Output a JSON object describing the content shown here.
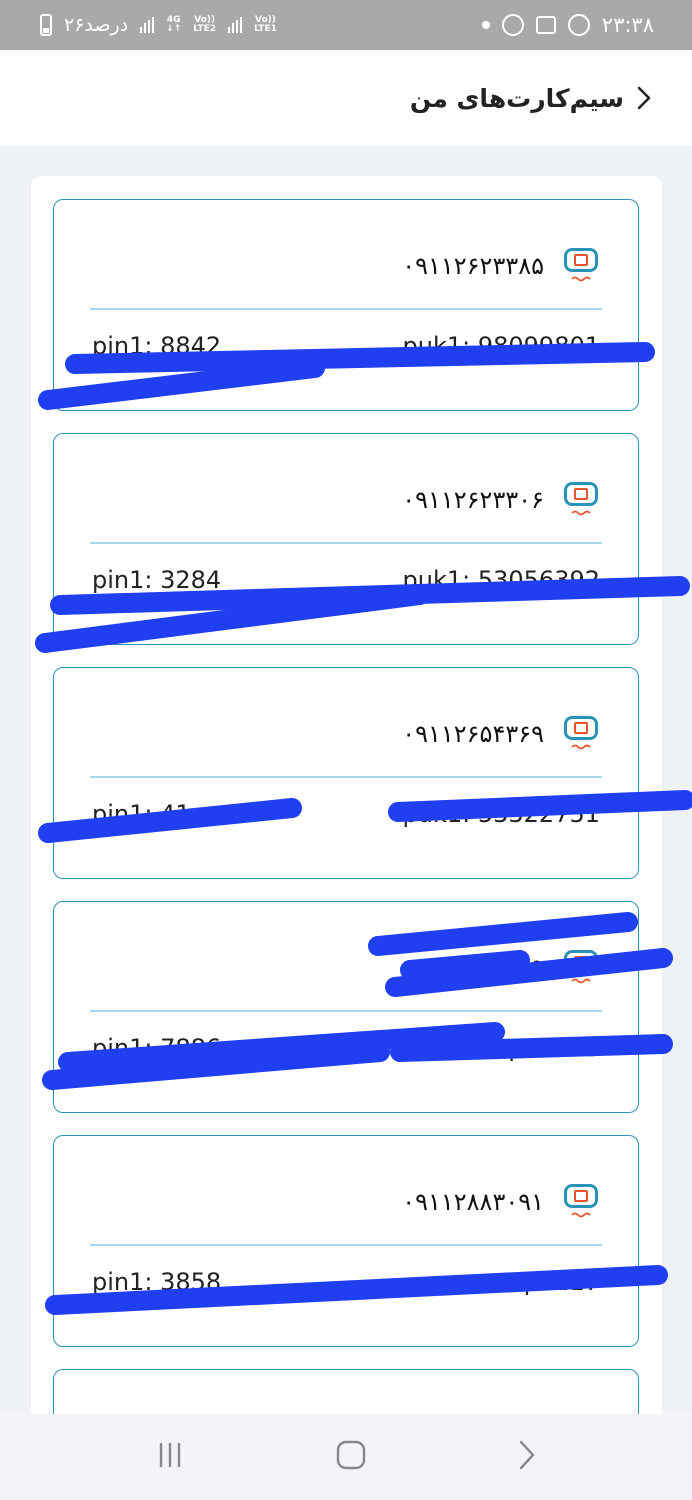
{
  "status_bar": {
    "time": "۲۳:۳۸",
    "battery": "۲۶درصد",
    "net_lte2": "LTE2",
    "net_lte1": "LTE1",
    "net_4g": "4G",
    "volte": "Vo))"
  },
  "header": {
    "title": "سیم‌کارت‌های من"
  },
  "cards": [
    {
      "number": "۰۹۱۱۲۶۲۳۳۸۵",
      "pin": "pin1: 8842",
      "puk": "puk1: 98099801"
    },
    {
      "number": "۰۹۱۱۲۶۲۳۳۰۶",
      "pin": "pin1: 3284",
      "puk": "puk1: 53056392"
    },
    {
      "number": "۰۹۱۱۲۶۵۴۳۶۹",
      "pin": "pin1: 41",
      "puk": "puk1: 53322751"
    },
    {
      "number": "۰۹",
      "pin": "pin1: 7886",
      "puk": "p99323"
    },
    {
      "number": "۰۹۱۱۲۸۸۳۰۹۱",
      "pin": "pin1: 3858",
      "puk": "p1217"
    },
    {
      "number": "",
      "pin": "",
      "puk": ""
    }
  ],
  "colors": {
    "accent": "#2a94b8",
    "chip": "#e4572e",
    "redaction": "#1f3ff0",
    "background": "#eef1f5"
  }
}
